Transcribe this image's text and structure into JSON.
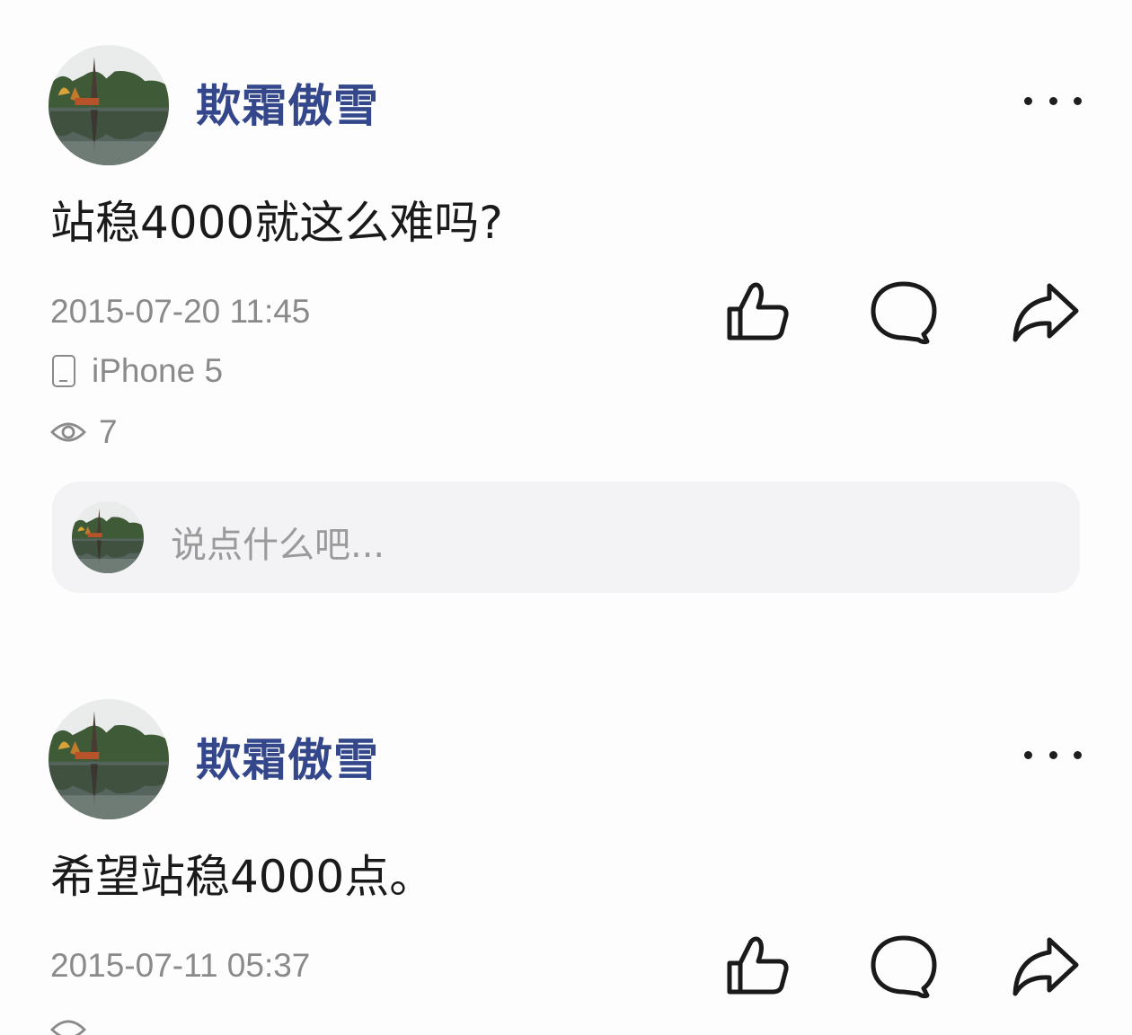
{
  "posts": [
    {
      "username": "欺霜傲雪",
      "content": "站稳4000就这么难吗?",
      "timestamp": "2015-07-20 11:45",
      "device": "iPhone 5",
      "views": "7",
      "comment_placeholder": "说点什么吧..."
    },
    {
      "username": "欺霜傲雪",
      "content": "希望站稳4000点。",
      "timestamp": "2015-07-11 05:37"
    }
  ],
  "icons": {
    "like": "thumbs-up-icon",
    "comment": "comment-bubble-icon",
    "share": "share-arrow-icon",
    "more": "more-dots-icon",
    "device": "phone-icon",
    "views": "eye-icon"
  },
  "colors": {
    "username": "#33478a",
    "meta_text": "#8a8a8a",
    "comment_box_bg": "#f3f3f5"
  }
}
